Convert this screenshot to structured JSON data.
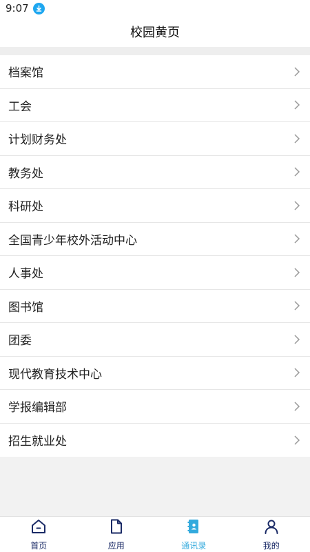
{
  "status": {
    "time": "9:07",
    "icon": "download-icon"
  },
  "header": {
    "title": "校园黄页"
  },
  "list": {
    "items": [
      {
        "label": "档案馆"
      },
      {
        "label": "工会"
      },
      {
        "label": "计划财务处"
      },
      {
        "label": "教务处"
      },
      {
        "label": "科研处"
      },
      {
        "label": "全国青少年校外活动中心"
      },
      {
        "label": "人事处"
      },
      {
        "label": "图书馆"
      },
      {
        "label": "团委"
      },
      {
        "label": "现代教育技术中心"
      },
      {
        "label": "学报编辑部"
      },
      {
        "label": "招生就业处"
      }
    ]
  },
  "nav": {
    "items": [
      {
        "label": "首页",
        "icon": "home-icon"
      },
      {
        "label": "应用",
        "icon": "document-icon"
      },
      {
        "label": "通讯录",
        "icon": "contacts-book-icon",
        "active": true
      },
      {
        "label": "我的",
        "icon": "user-icon"
      }
    ],
    "colors": {
      "default": "#1a2a66",
      "active": "#33aadd"
    }
  }
}
